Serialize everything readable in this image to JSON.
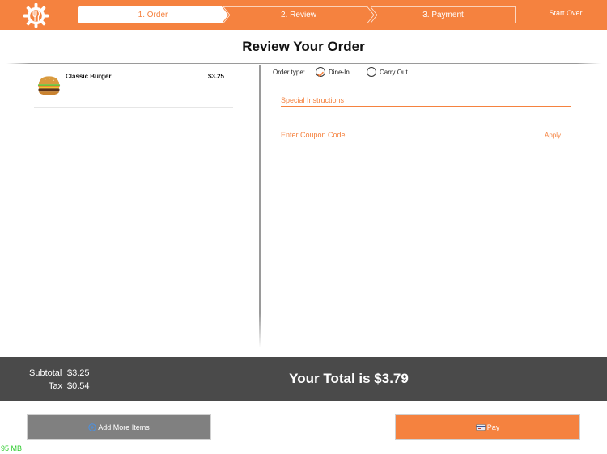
{
  "colors": {
    "brand": "#f5823f",
    "totals_bar": "#4a4a4a",
    "secondary_button": "#808080",
    "memory_text": "#2ecc2e"
  },
  "header": {
    "logo_icon": "gear-fork-knife-icon",
    "steps": [
      {
        "label": "1. Order"
      },
      {
        "label": "2. Review"
      },
      {
        "label": "3. Payment"
      }
    ],
    "start_over": "Start Over"
  },
  "page": {
    "title": "Review Your Order"
  },
  "cart": {
    "items": [
      {
        "name": "Classic Burger",
        "price": "$3.25",
        "image_icon": "burger-icon"
      }
    ]
  },
  "order_type": {
    "label": "Order type:",
    "options": [
      {
        "label": "Dine-In",
        "selected": true
      },
      {
        "label": "Carry Out",
        "selected": false
      }
    ]
  },
  "special_instructions": {
    "placeholder": "Special Instructions",
    "value": ""
  },
  "coupon": {
    "placeholder": "Enter Coupon Code",
    "value": "",
    "apply_label": "Apply"
  },
  "totals": {
    "subtotal_label": "Subtotal",
    "subtotal_value": "$3.25",
    "tax_label": "Tax",
    "tax_value": "$0.54",
    "total_text": "Your Total is $3.79"
  },
  "actions": {
    "add_more": {
      "label": "Add More Items",
      "icon": "plus-circle-icon"
    },
    "pay": {
      "label": "Pay",
      "icon": "credit-card-icon"
    }
  },
  "debug": {
    "memory": "95 MB"
  }
}
